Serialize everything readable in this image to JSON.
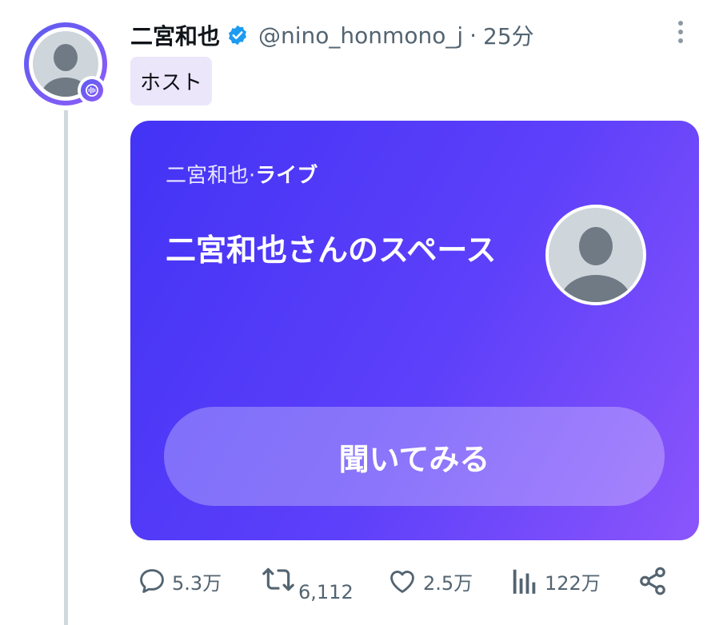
{
  "tweet": {
    "display_name": "二宮和也",
    "handle": "@nino_honmono_j",
    "separator": "·",
    "time": "25分",
    "host_label": "ホスト"
  },
  "space": {
    "host_name": "二宮和也",
    "status_separator": "·",
    "status": "ライブ",
    "title": "二宮和也さんのスペース",
    "listen_label": "聞いてみる"
  },
  "actions": {
    "replies": "5.3万",
    "retweets": "6,112",
    "likes": "2.5万",
    "views": "122万"
  },
  "icons": {
    "verified": "verified-badge-icon",
    "more": "more-vertical-icon",
    "host": "microphone-icon",
    "reply": "reply-icon",
    "retweet": "retweet-icon",
    "like": "heart-icon",
    "views": "bar-chart-icon",
    "share": "share-icon"
  },
  "colors": {
    "accent": "#1d9bf0",
    "space_gradient_start": "#4333f5",
    "space_gradient_end": "#8b55fb",
    "host_tag_bg": "#ece6fb",
    "secondary_text": "#536471"
  }
}
